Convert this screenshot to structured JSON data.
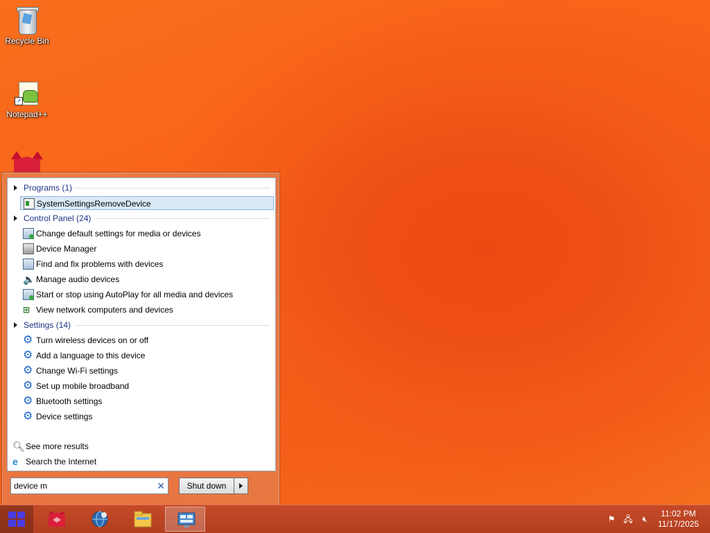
{
  "desktop": {
    "icons": [
      {
        "label": "Recycle Bin",
        "icon": "recycle-bin-icon"
      },
      {
        "label": "Notepad++",
        "icon": "notepad-plus-plus-icon"
      }
    ]
  },
  "start_menu": {
    "groups": [
      {
        "title": "Programs (1)",
        "items": [
          "SystemSettingsRemoveDevice"
        ]
      },
      {
        "title": "Control Panel (24)",
        "items": [
          "Change default settings for media or devices",
          "Device Manager",
          "Find and fix problems with devices",
          "Manage audio devices",
          "Start or stop using AutoPlay for all media and devices",
          "View network computers and devices"
        ]
      },
      {
        "title": "Settings (14)",
        "items": [
          "Turn wireless devices on or off",
          "Add a language to this device",
          "Change Wi-Fi settings",
          "Set up mobile broadband",
          "Bluetooth settings",
          "Device settings"
        ]
      }
    ],
    "see_more": "See more results",
    "search_internet": "Search the Internet",
    "search": {
      "value": "device m"
    },
    "shutdown_label": "Shut down"
  },
  "taskbar": {
    "apps": [
      "red-app-icon",
      "browser-icon",
      "file-explorer-icon",
      "control-panel-icon"
    ],
    "tray": [
      "action-center-flag-icon",
      "network-icon",
      "volume-muted-icon"
    ],
    "clock": {
      "time": "11:02 PM",
      "date": "11/17/2025"
    }
  },
  "colors": {
    "accent": "#1e3287",
    "selection": "#dbe9f7",
    "taskbar": "#b8431f",
    "start_logo": "#4a3ce0"
  }
}
